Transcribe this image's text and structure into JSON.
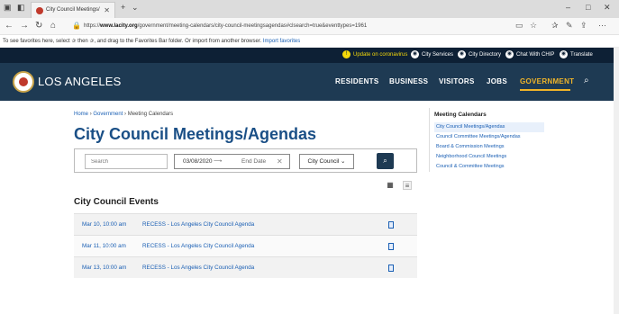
{
  "browser": {
    "tab_title": "City Council Meetings/",
    "url_prefix": "https://",
    "url_domain": "www.lacity.org",
    "url_path": "/government/meeting-calendars/city-council-meetingsagendas#clsearch=true&eventtypes=1961",
    "favorites_message": "To see favorites here, select ✰ then ✰, and drag to the Favorites Bar folder. Or import from another browser.",
    "import_link": "Import favorites"
  },
  "utility": {
    "alert_label": "Update on coronavirus",
    "city_services": "City Services",
    "city_directory": "City Directory",
    "chat": "Chat With CHIP",
    "translate": "Translate"
  },
  "nav": {
    "site_name": "LOS ANGELES",
    "items": [
      "RESIDENTS",
      "BUSINESS",
      "VISITORS",
      "JOBS",
      "GOVERNMENT"
    ]
  },
  "breadcrumb": {
    "home": "Home",
    "government": "Government",
    "current": "Meeting Calendars",
    "separator": "›"
  },
  "page": {
    "title": "City Council Meetings/Agendas"
  },
  "filters": {
    "search_placeholder": "Search",
    "start_date": "03/08/2020",
    "arrow": "⟶",
    "end_date_placeholder": "End Date",
    "council_select": "City Council ⌄"
  },
  "events": {
    "heading": "City Council Events",
    "rows": [
      {
        "date": "Mar 10, 10:00 am",
        "title": "RECESS - Los Angeles City Council Agenda"
      },
      {
        "date": "Mar 11, 10:00 am",
        "title": "RECESS - Los Angeles City Council Agenda"
      },
      {
        "date": "Mar 13, 10:00 am",
        "title": "RECESS - Los Angeles City Council Agenda"
      }
    ]
  },
  "sidebar": {
    "title": "Meeting Calendars",
    "items": [
      "City Council Meetings/Agendas",
      "Council Committee Meetings/Agendas",
      "Board & Commission Meetings",
      "Neighborhood Council Meetings",
      "Council & Committee Meetings"
    ]
  }
}
